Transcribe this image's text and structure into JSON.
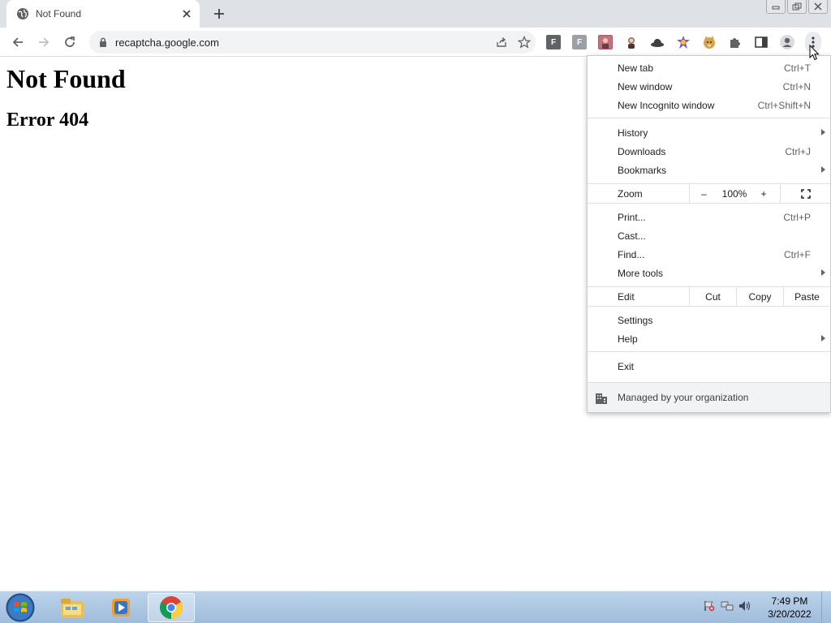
{
  "browser": {
    "tab": {
      "title": "Not Found",
      "favicon": "globe-icon"
    },
    "omnibox": {
      "url": "recaptcha.google.com"
    },
    "extensions": [
      {
        "name": "extension-f-1-icon",
        "label": "F",
        "color": "#5f6368"
      },
      {
        "name": "extension-f-2-icon",
        "label": "F",
        "color": "#80868b"
      },
      {
        "name": "extension-avatar-1-icon",
        "label": "",
        "color": "#b0596a"
      },
      {
        "name": "extension-avatar-2-icon",
        "label": "",
        "color": "#6b5b4b"
      },
      {
        "name": "extension-hat-icon",
        "label": "",
        "color": "#3c4043"
      },
      {
        "name": "extension-star-icon",
        "label": "",
        "color": "#7e57c2"
      },
      {
        "name": "extension-doge-icon",
        "label": "",
        "color": "#d7a34a"
      }
    ]
  },
  "page": {
    "heading": "Not Found",
    "subheading": "Error 404"
  },
  "menu": {
    "new_tab": {
      "label": "New tab",
      "shortcut": "Ctrl+T"
    },
    "new_window": {
      "label": "New window",
      "shortcut": "Ctrl+N"
    },
    "new_incognito": {
      "label": "New Incognito window",
      "shortcut": "Ctrl+Shift+N"
    },
    "history": {
      "label": "History"
    },
    "downloads": {
      "label": "Downloads",
      "shortcut": "Ctrl+J"
    },
    "bookmarks": {
      "label": "Bookmarks"
    },
    "zoom": {
      "label": "Zoom",
      "minus": "–",
      "value": "100%",
      "plus": "+"
    },
    "print": {
      "label": "Print...",
      "shortcut": "Ctrl+P"
    },
    "cast": {
      "label": "Cast..."
    },
    "find": {
      "label": "Find...",
      "shortcut": "Ctrl+F"
    },
    "more_tools": {
      "label": "More tools"
    },
    "edit": {
      "label": "Edit",
      "cut": "Cut",
      "copy": "Copy",
      "paste": "Paste"
    },
    "settings": {
      "label": "Settings"
    },
    "help": {
      "label": "Help"
    },
    "exit": {
      "label": "Exit"
    },
    "managed": {
      "label": "Managed by your organization"
    }
  },
  "taskbar": {
    "time": "7:49 PM",
    "date": "3/20/2022"
  }
}
